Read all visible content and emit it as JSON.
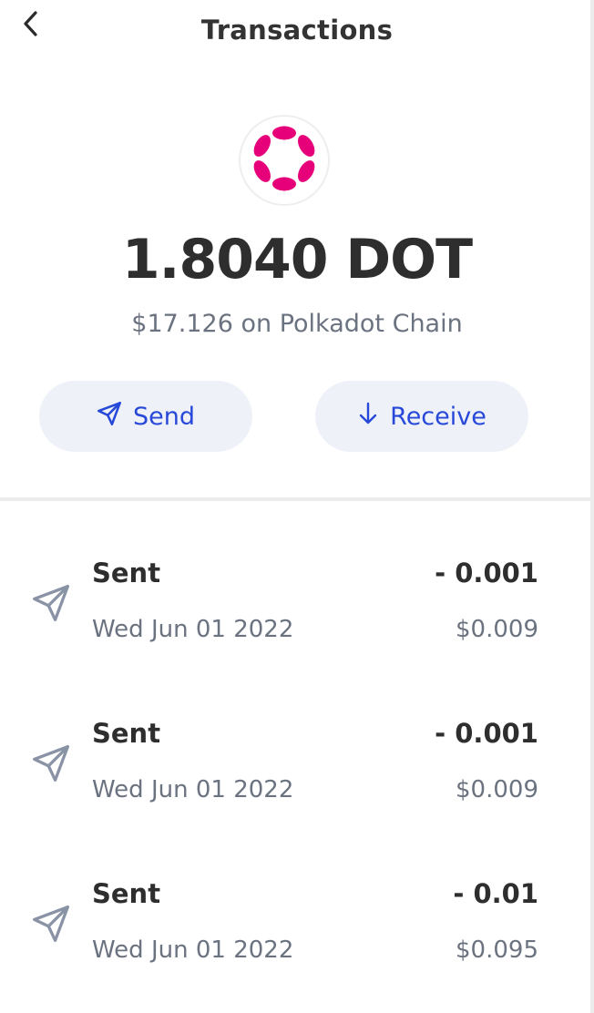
{
  "header": {
    "back_icon": "chevron-left-icon",
    "title": "Transactions"
  },
  "asset": {
    "logo_icon": "polkadot-logo-icon",
    "logo_color": "#e6007a",
    "balance": "1.8040 DOT",
    "fiat_line": "$17.126 on Polkadot Chain"
  },
  "actions": {
    "send_label": "Send",
    "send_icon": "paper-plane-icon",
    "receive_label": "Receive",
    "receive_icon": "arrow-down-icon",
    "accent_color": "#2748d8"
  },
  "transactions": [
    {
      "type": "Sent",
      "date": "Wed Jun 01 2022",
      "amount": "- 0.001",
      "fiat": "$0.009",
      "icon": "paper-plane-icon"
    },
    {
      "type": "Sent",
      "date": "Wed Jun 01 2022",
      "amount": "- 0.001",
      "fiat": "$0.009",
      "icon": "paper-plane-icon"
    },
    {
      "type": "Sent",
      "date": "Wed Jun 01 2022",
      "amount": "- 0.01",
      "fiat": "$0.095",
      "icon": "paper-plane-icon"
    }
  ]
}
